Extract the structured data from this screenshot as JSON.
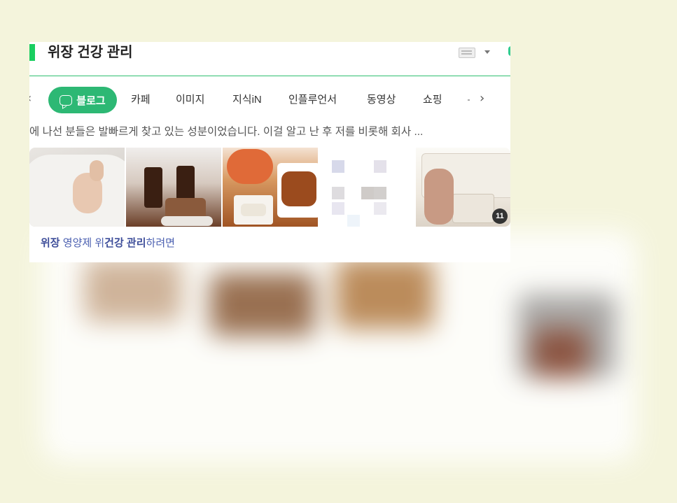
{
  "search": {
    "query": "위장 건강 관리"
  },
  "tabs": {
    "active_label": "블로그",
    "items": [
      "카페",
      "이미지",
      "지식iN",
      "인플루언서",
      "동영상",
      "쇼핑"
    ]
  },
  "icons": {
    "prev": "chevron-left-icon",
    "next": "chevron-right-icon",
    "blog": "speech-bubble-icon",
    "keyboard": "keyboard-icon",
    "dropdown": "caret-down-icon"
  },
  "result": {
    "snippet": "에 나선 분들은 발빠르게 찾고 있는 성분이었습니다. 이걸 알고 난 후 저를 비롯해 회사 ...",
    "image_count": "11",
    "title_parts": [
      {
        "text": "위장",
        "bold": true
      },
      {
        "text": " 영양제 위",
        "bold": false
      },
      {
        "text": "건강 관리",
        "bold": true
      },
      {
        "text": "하려면",
        "bold": false
      }
    ]
  },
  "colors": {
    "accent_green": "#2db874",
    "background": "#f4f4dc",
    "link_blue": "#4a5fb0"
  }
}
